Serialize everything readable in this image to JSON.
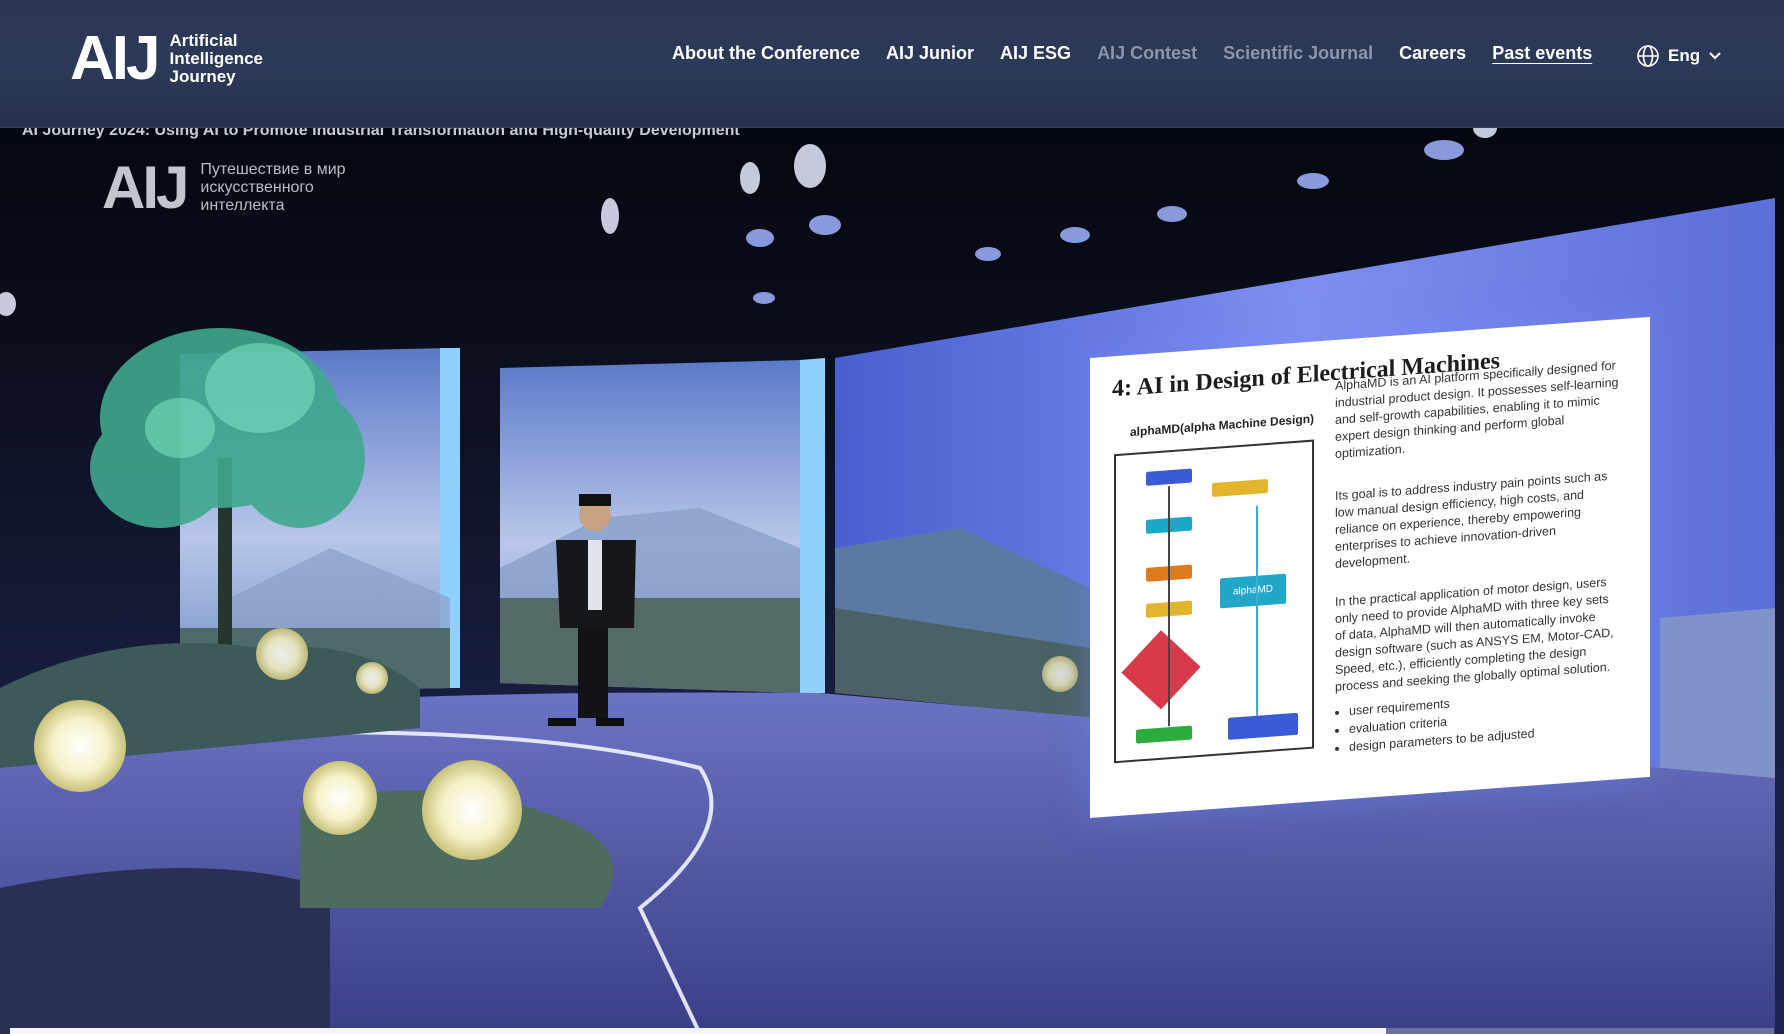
{
  "header": {
    "logo": {
      "mark": "AIJ",
      "line1": "Artificial",
      "line2": "Intelligence",
      "line3": "Journey"
    },
    "nav": [
      {
        "label": "About the Conference",
        "state": "normal"
      },
      {
        "label": "AIJ Junior",
        "state": "normal"
      },
      {
        "label": "AIJ ESG",
        "state": "normal"
      },
      {
        "label": "AIJ Contest",
        "state": "dim"
      },
      {
        "label": "Scientific Journal",
        "state": "dim"
      },
      {
        "label": "Careers",
        "state": "normal"
      },
      {
        "label": "Past events",
        "state": "underlined"
      }
    ],
    "language": {
      "icon": "globe-icon",
      "label": "Eng",
      "dropdown_icon": "chevron-down-icon"
    }
  },
  "video": {
    "strip_title": "AI Journey 2024: Using AI to Promote Industrial Transformation and High-quality Development",
    "logo": {
      "mark": "AIJ",
      "line1": "Путешествие в мир",
      "line2": "искусственного",
      "line3": "интеллекта"
    },
    "slide": {
      "title": "4: AI in Design of Electrical Machines",
      "subtitle": "alphaMD(alpha Machine Design)",
      "paragraph1": "AlphaMD is an AI platform specifically designed for industrial product design. It possesses self-learning and self-growth capabilities, enabling it to mimic expert design thinking and perform global optimization.",
      "paragraph2": "Its goal is to address industry pain points such as low manual design efficiency, high costs, and reliance on experience, thereby empowering enterprises to achieve innovation-driven development.",
      "paragraph3": "In the practical application of motor design, users only need to provide AlphaMD with three key sets of data, AlphaMD will then automatically invoke design software (such as ANSYS EM, Motor-CAD, Speed, etc.), efficiently completing the design process and seeking the globally optimal solution.",
      "bullets": [
        "user requirements",
        "evaluation criteria",
        "design parameters to be adjusted"
      ],
      "flow_center_label": "alphaMD"
    },
    "progress_percent": 78
  }
}
